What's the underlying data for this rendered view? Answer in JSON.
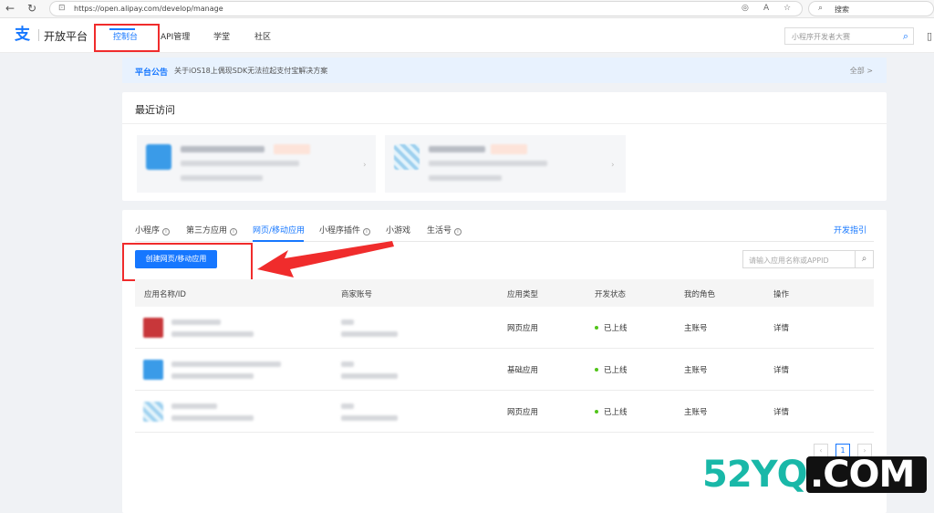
{
  "browser": {
    "url": "https://open.alipay.com/develop/manage",
    "search_label": "搜索"
  },
  "header": {
    "logo_mark": "支",
    "logo_text": "开放平台",
    "nav": [
      "控制台",
      "API管理",
      "学堂",
      "社区"
    ],
    "search_placeholder": "小程序开发者大赛"
  },
  "notice": {
    "label": "平台公告",
    "text": "关于iOS18上偶现SDK无法拉起支付宝解决方案",
    "all": "全部 >"
  },
  "recent": {
    "title": "最近访问"
  },
  "tabs": [
    "小程序",
    "第三方应用",
    "网页/移动应用",
    "小程序插件",
    "小游戏",
    "生活号"
  ],
  "dev_guide": "开发指引",
  "create_button": "创建网页/移动应用",
  "app_search_placeholder": "请输入应用名称或APPID",
  "table": {
    "headers": [
      "应用名称/ID",
      "商家账号",
      "应用类型",
      "开发状态",
      "我的角色",
      "操作"
    ],
    "rows": [
      {
        "type": "网页应用",
        "status": "已上线",
        "role": "主账号",
        "action": "详情",
        "icon_color": "#c8373a"
      },
      {
        "type": "基础应用",
        "status": "已上线",
        "role": "主账号",
        "action": "详情",
        "icon_color": "#3a9be8"
      },
      {
        "type": "网页应用",
        "status": "已上线",
        "role": "主账号",
        "action": "详情",
        "icon_color": "#7fc1e8"
      }
    ]
  },
  "pagination": {
    "current": "1"
  },
  "watermark": {
    "left": "52YQ",
    "right": ".COM"
  },
  "colors": {
    "accent": "#1677ff",
    "annotation": "#f02c2c",
    "status_online": "#52c41a"
  }
}
